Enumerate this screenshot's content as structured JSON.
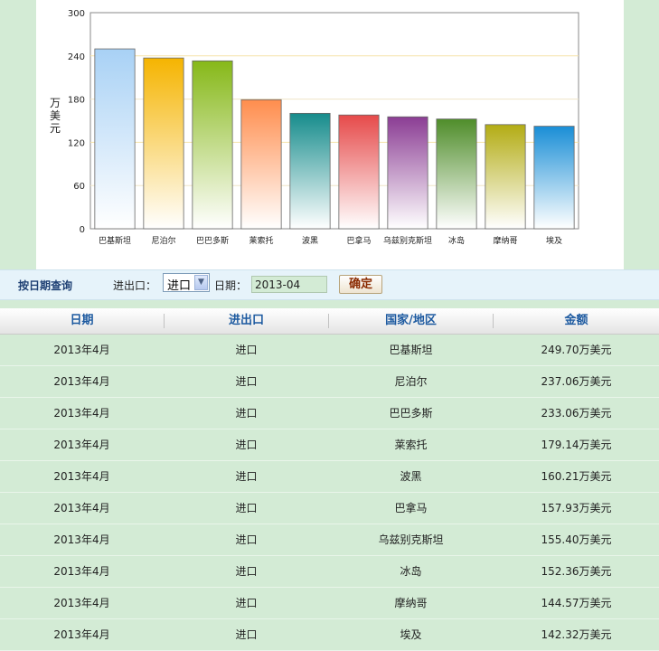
{
  "chart_data": {
    "type": "bar",
    "ylabel": "万美元",
    "ylim": [
      0,
      300
    ],
    "yticks": [
      0,
      60,
      120,
      180,
      240,
      300
    ],
    "categories": [
      "巴基斯坦",
      "尼泊尔",
      "巴巴多斯",
      "莱索托",
      "波黑",
      "巴拿马",
      "乌兹别克斯坦",
      "冰岛",
      "摩纳哥",
      "埃及"
    ],
    "values": [
      249.7,
      237.06,
      233.06,
      179.14,
      160.21,
      157.93,
      155.4,
      152.36,
      144.57,
      142.32
    ],
    "colors": [
      "#a8d1f5",
      "#f5b400",
      "#86b818",
      "#ff8d4d",
      "#168c8c",
      "#e64a4a",
      "#8b3d94",
      "#4f8d2a",
      "#b3ac14",
      "#1a8ed6"
    ]
  },
  "filter": {
    "title": "按日期查询",
    "io_label": "进出口：",
    "io_value": "进口",
    "date_label": "日期：",
    "date_value": "2013-04",
    "submit_label": "确定"
  },
  "table": {
    "headers": [
      "日期",
      "进出口",
      "国家/地区",
      "金额"
    ],
    "rows": [
      [
        "2013年4月",
        "进口",
        "巴基斯坦",
        "249.70万美元"
      ],
      [
        "2013年4月",
        "进口",
        "尼泊尔",
        "237.06万美元"
      ],
      [
        "2013年4月",
        "进口",
        "巴巴多斯",
        "233.06万美元"
      ],
      [
        "2013年4月",
        "进口",
        "莱索托",
        "179.14万美元"
      ],
      [
        "2013年4月",
        "进口",
        "波黑",
        "160.21万美元"
      ],
      [
        "2013年4月",
        "进口",
        "巴拿马",
        "157.93万美元"
      ],
      [
        "2013年4月",
        "进口",
        "乌兹别克斯坦",
        "155.40万美元"
      ],
      [
        "2013年4月",
        "进口",
        "冰岛",
        "152.36万美元"
      ],
      [
        "2013年4月",
        "进口",
        "摩纳哥",
        "144.57万美元"
      ],
      [
        "2013年4月",
        "进口",
        "埃及",
        "142.32万美元"
      ]
    ]
  }
}
